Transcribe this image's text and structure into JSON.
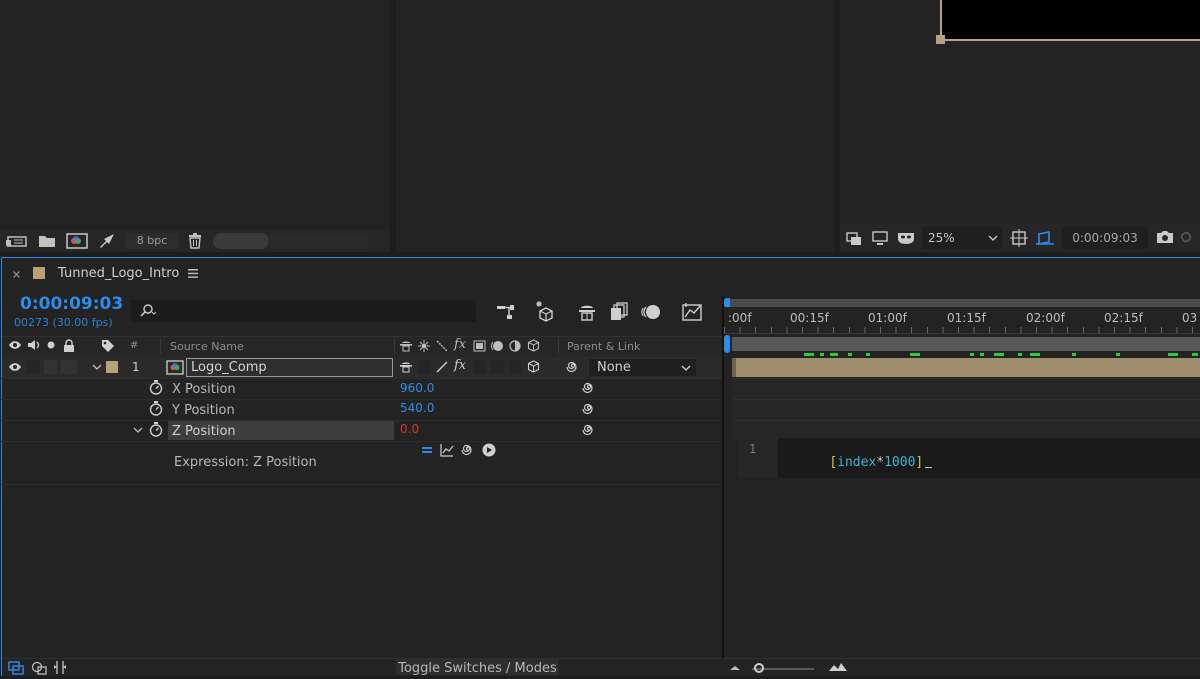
{
  "project_panel": {
    "bpc_label": "8 bpc",
    "icons": [
      "interpret-footage-icon",
      "folder-icon",
      "new-composition-icon",
      "render-queue-icon",
      "trash-icon"
    ]
  },
  "viewer": {
    "zoom": "25%",
    "timecode": "0:00:09:03",
    "icons": [
      "snapshot-show-icon",
      "monitor-icon",
      "mask-visibility-icon",
      "region-of-interest-icon",
      "transparency-grid-icon",
      "camera-icon"
    ]
  },
  "timeline": {
    "tab_title": "Tunned_Logo_Intro",
    "current_time": "0:00:09:03",
    "frame_info": "00273 (30.00 fps)",
    "columns": {
      "num": "#",
      "source_name": "Source Name",
      "parent_link": "Parent & Link"
    },
    "ruler_labels": [
      ":00f",
      "00:15f",
      "01:00f",
      "01:15f",
      "02:00f",
      "02:15f",
      "03"
    ],
    "layer": {
      "number": "1",
      "name": "Logo_Comp",
      "parent": "None"
    },
    "properties": [
      {
        "name": "X Position",
        "value": "960.0"
      },
      {
        "name": "Y Position",
        "value": "540.0"
      },
      {
        "name": "Z Position",
        "value": "0.0"
      }
    ],
    "expression_label": "Expression: Z Position",
    "expression_line": "1",
    "expression_code": {
      "open": "[",
      "word": "index",
      "op": "*",
      "num": "1000",
      "close": "]"
    },
    "bottom_bar": {
      "toggle_label": "Toggle Switches / Modes"
    },
    "colors": {
      "accent": "#2d8ceb",
      "layer_label": "#b79f78",
      "track_bar": "#9d8d6c",
      "keyframe_green": "#2ecc40",
      "z_value": "#d9302f"
    }
  }
}
